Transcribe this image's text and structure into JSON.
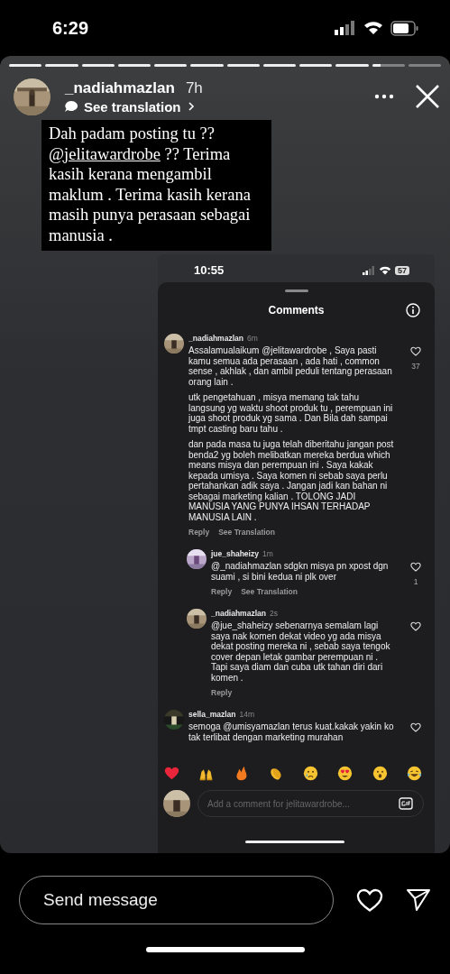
{
  "status_bar": {
    "time": "6:29"
  },
  "story": {
    "progress": [
      {
        "level": 1
      },
      {
        "level": 1
      },
      {
        "level": 1
      },
      {
        "level": 1
      },
      {
        "level": 1
      },
      {
        "level": 1
      },
      {
        "level": 1
      },
      {
        "level": 1
      },
      {
        "level": 1
      },
      {
        "level": 1
      },
      {
        "level": 0.25
      },
      {
        "level": 0
      }
    ],
    "user": "_nadiahmazlan",
    "age": "7h",
    "translation": "See translation",
    "caption": [
      {
        "kind": "text",
        "text": "Dah padam posting tu ??"
      },
      {
        "kind": "mention",
        "text": "@jelitawardrobe"
      },
      {
        "kind": "text",
        "text": "?? Terima kasih kerana mengambil maklum . Terima kasih kerana masih punya perasaan sebagai manusia ."
      }
    ]
  },
  "screenshot": {
    "time": "10:55",
    "battery": "57",
    "title": "Comments",
    "comments": [
      {
        "user": "_nadiahmazlan",
        "age": "6m",
        "reply": false,
        "paragraphs": [
          "Assalamualaikum @jelitawardrobe , Saya pasti kamu semua ada perasaan , ada hati , common sense , akhlak , dan ambil peduli tentang perasaan orang lain .",
          "utk pengetahuan , misya memang tak tahu langsung yg waktu shoot produk tu , perempuan ini juga shoot produk yg sama . Dan Bila dah sampai tmpt casting baru tahu .",
          "dan pada masa tu juga telah diberitahu jangan post benda2 yg boleh melibatkan mereka berdua which means misya dan perempuan ini . Saya kakak kepada umisya . Saya komen ni sebab saya perlu pertahankan adik saya . Jangan jadi kan bahan ni sebagai marketing kalian . TOLONG JADI MANUSIA YANG PUNYA IHSAN TERHADAP MANUSIA LAIN ."
        ],
        "actions": [
          "Reply",
          "See Translation"
        ],
        "likes": "37"
      },
      {
        "user": "jue_shaheizy",
        "age": "1m",
        "reply": true,
        "paragraphs": [
          "@_nadiahmazlan sdgkn misya pn xpost dgn suami , si bini kedua ni plk over"
        ],
        "actions": [
          "Reply",
          "See Translation"
        ],
        "likes": "1"
      },
      {
        "user": "_nadiahmazlan",
        "age": "2s",
        "reply": true,
        "paragraphs": [
          "@jue_shaheizy sebenarnya semalam lagi saya nak komen dekat video yg ada misya dekat posting mereka ni , sebab saya tengok cover depan letak gambar perempuan ni . Tapi saya diam dan cuba utk tahan diri dari komen ."
        ],
        "actions": [
          "Reply"
        ]
      },
      {
        "user": "sella_mazlan",
        "age": "14m",
        "reply": false,
        "paragraphs": [
          "semoga @umisyamazlan terus kuat.kakak yakin ko tak terlibat dengan marketing murahan"
        ]
      }
    ],
    "comment_placeholder": "Add a comment for jelitawardrobe..."
  },
  "message": {
    "placeholder": "Send message"
  }
}
